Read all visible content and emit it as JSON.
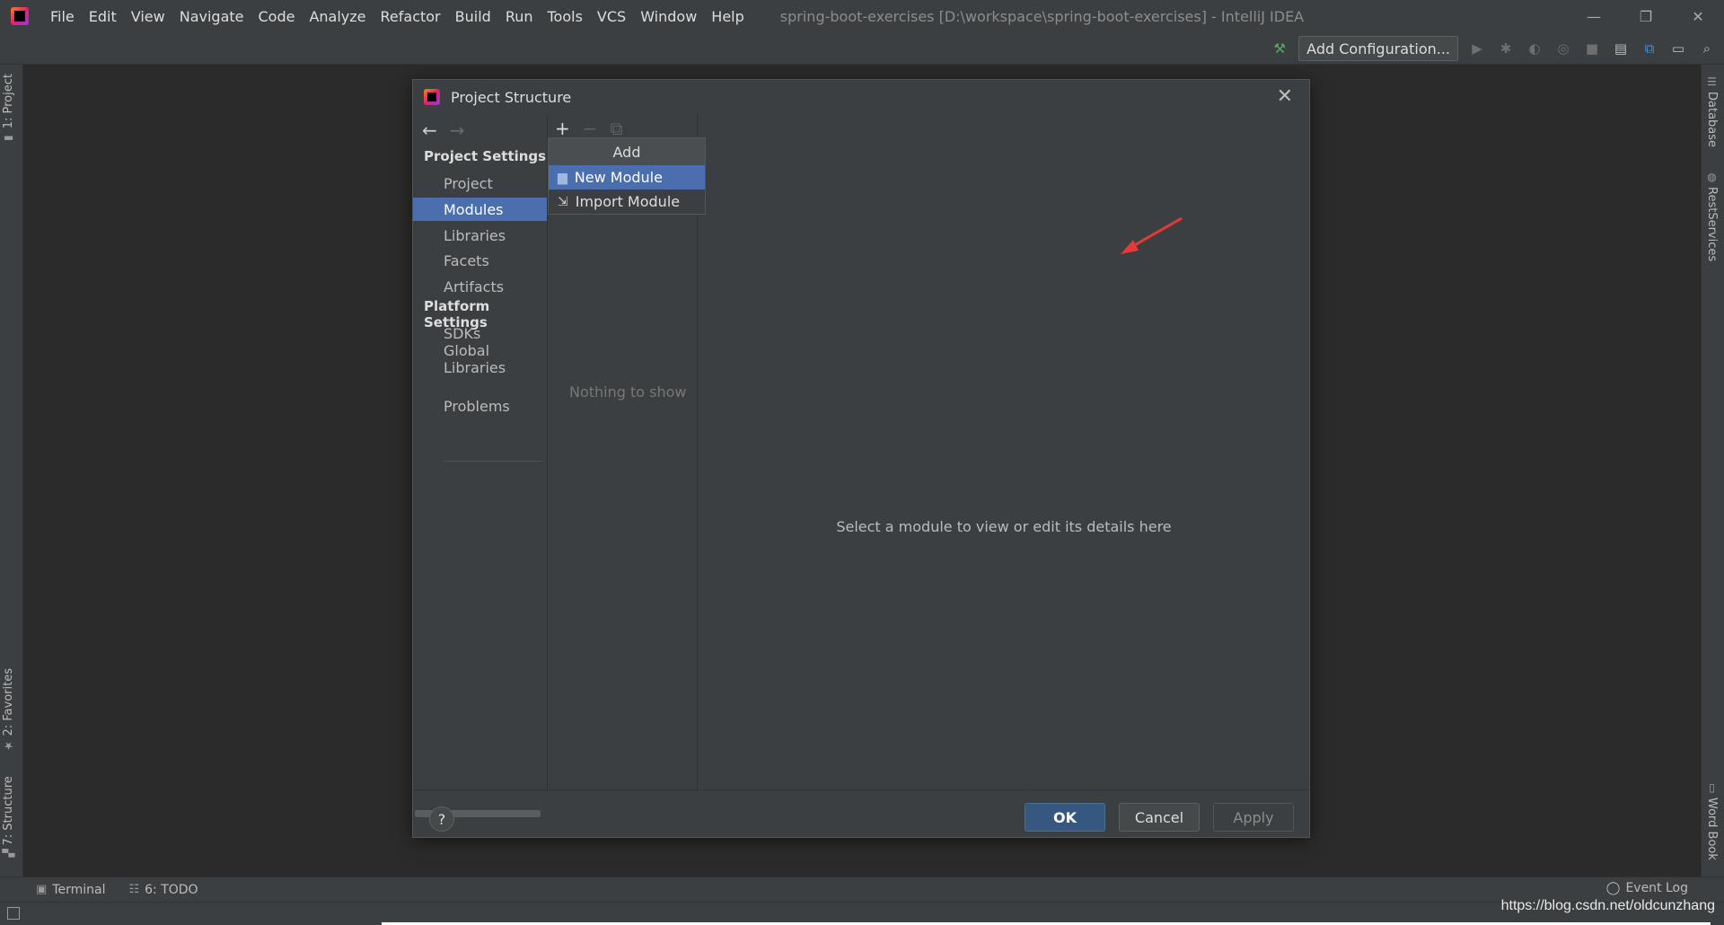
{
  "window": {
    "menu": [
      "File",
      "Edit",
      "View",
      "Navigate",
      "Code",
      "Analyze",
      "Refactor",
      "Build",
      "Run",
      "Tools",
      "VCS",
      "Window",
      "Help"
    ],
    "title": "spring-boot-exercises [D:\\workspace\\spring-boot-exercises] - IntelliJ IDEA",
    "controls": [
      "—",
      "❐",
      "✕"
    ]
  },
  "toolbar": {
    "add_configuration": "Add Configuration..."
  },
  "left_strip": {
    "project": "1: Project",
    "favorites": "2: Favorites",
    "structure": "7: Structure"
  },
  "right_strip": {
    "database": "Database",
    "rest_services": "RestServices",
    "word_book": "Word Book"
  },
  "bottom": {
    "terminal": "Terminal",
    "todo": "6: TODO",
    "event_log": "Event Log"
  },
  "watermark": "https://blog.csdn.net/oldcunzhang",
  "dialog": {
    "title": "Project Structure",
    "sections": {
      "project_settings": "Project Settings",
      "platform_settings": "Platform Settings"
    },
    "nav": {
      "project": "Project",
      "modules": "Modules",
      "libraries": "Libraries",
      "facets": "Facets",
      "artifacts": "Artifacts",
      "sdks": "SDKs",
      "global_libraries": "Global Libraries",
      "problems": "Problems"
    },
    "selected_nav": "Modules",
    "middle_empty": "Nothing to show",
    "detail_message": "Select a module to view or edit its details here",
    "popup": {
      "header": "Add",
      "items": [
        "New Module",
        "Import Module"
      ],
      "selected": "New Module"
    },
    "buttons": {
      "help": "?",
      "ok": "OK",
      "cancel": "Cancel",
      "apply": "Apply"
    }
  },
  "colors": {
    "selection": "#4b6eaf",
    "ok_button": "#365880",
    "annotation_arrow": "#e53935"
  }
}
